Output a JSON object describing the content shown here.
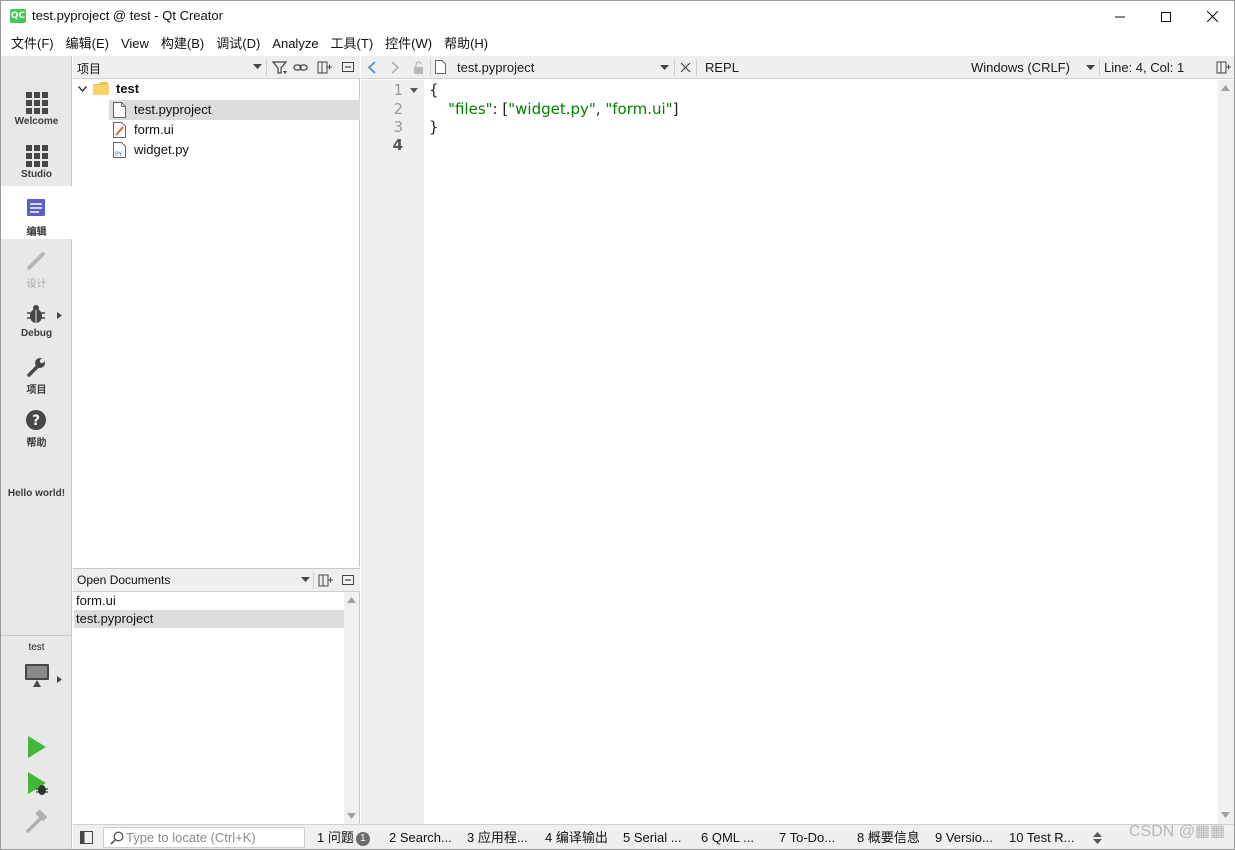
{
  "window": {
    "app_logo": "QC",
    "title": "test.pyproject @ test - Qt Creator"
  },
  "menu": [
    "文件(F)",
    "编辑(E)",
    "View",
    "构建(B)",
    "调试(D)",
    "Analyze",
    "工具(T)",
    "控件(W)",
    "帮助(H)"
  ],
  "modes": {
    "welcome": "Welcome",
    "studio": "Studio",
    "edit": "编辑",
    "design": "设计",
    "debug": "Debug",
    "projects": "项目",
    "help": "帮助"
  },
  "sidebar_message": "Hello world!",
  "kit": {
    "name": "test"
  },
  "project_pane": {
    "title": "项目",
    "root": "test",
    "files": [
      "test.pyproject",
      "form.ui",
      "widget.py"
    ],
    "selected": "test.pyproject"
  },
  "open_documents": {
    "title": "Open Documents",
    "items": [
      "form.ui",
      "test.pyproject"
    ],
    "selected": "test.pyproject"
  },
  "editor": {
    "file_name": "test.pyproject",
    "repl_label": "REPL",
    "line_ending": "Windows (CRLF)",
    "cursor_position": "Line: 4, Col: 1",
    "line_numbers": [
      "1",
      "2",
      "3",
      "4"
    ],
    "current_line": "4",
    "code": {
      "open_brace": "{",
      "key": "\"files\"",
      "colon": ": [",
      "val1": "\"widget.py\"",
      "comma": ", ",
      "val2": "\"form.ui\"",
      "close_bracket": "]",
      "close_brace": "}"
    }
  },
  "status_bar": {
    "locate_placeholder": "Type to locate (Ctrl+K)",
    "tabs": [
      {
        "label": "1  问题",
        "badge": "1"
      },
      {
        "label": "2  Search..."
      },
      {
        "label": "3  应用程..."
      },
      {
        "label": "4  编译输出"
      },
      {
        "label": "5  Serial ..."
      },
      {
        "label": "6  QML ..."
      },
      {
        "label": "7  To-Do..."
      },
      {
        "label": "8  概要信息"
      },
      {
        "label": "9  Versio..."
      },
      {
        "label": "10  Test R..."
      }
    ]
  },
  "watermark": "CSDN @▦▦",
  "colors": {
    "accent_run": "#41b83a",
    "string": "#008000",
    "mode_active_icon": "#5b5fc7",
    "logo": "#41cd52"
  },
  "icons": {
    "modes": [
      "grid-icon",
      "grid-icon",
      "edit-doc-icon",
      "pencil-icon",
      "bug-icon",
      "wrench-icon",
      "help-icon"
    ],
    "run": "run-icon",
    "debug_run": "debug-run-icon",
    "build": "hammer-icon"
  }
}
